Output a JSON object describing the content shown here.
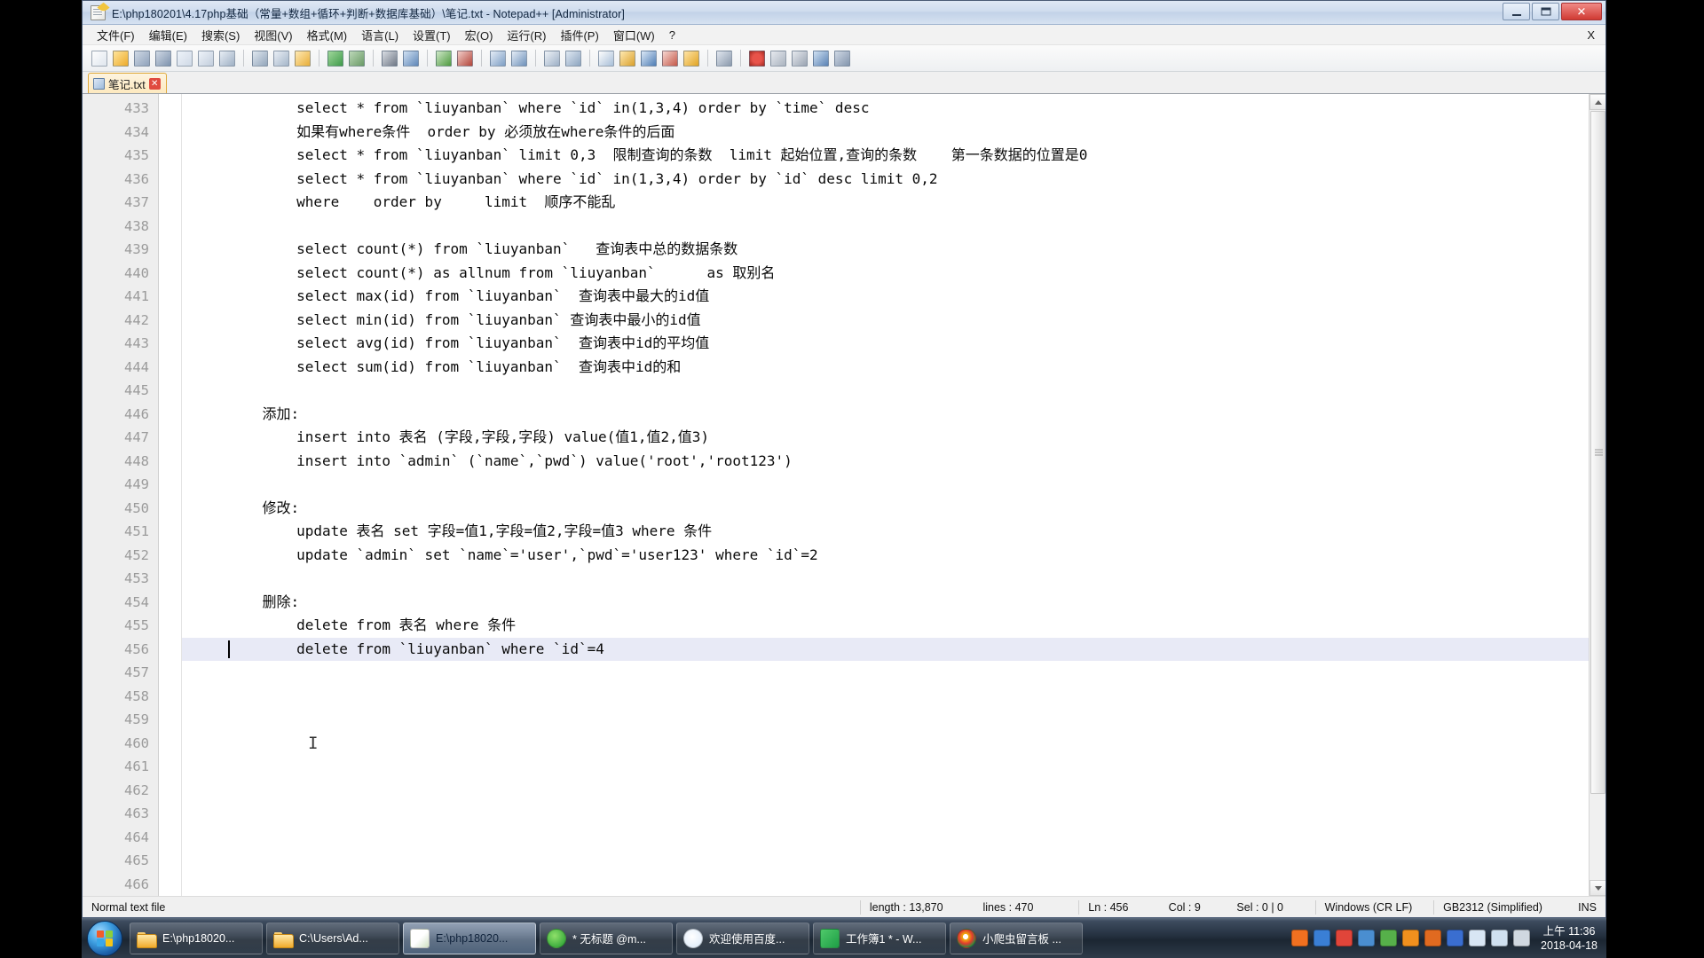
{
  "window": {
    "title": "E:\\php180201\\4.17php基础（常量+数组+循环+判断+数据库基础）\\笔记.txt - Notepad++ [Administrator]",
    "icon": "notepad-plus-plus-icon",
    "minimize_label": "—",
    "maximize_label": "▢",
    "close_label": "✕"
  },
  "menu": {
    "items": [
      {
        "label": "文件(F)"
      },
      {
        "label": "编辑(E)"
      },
      {
        "label": "搜索(S)"
      },
      {
        "label": "视图(V)"
      },
      {
        "label": "格式(M)"
      },
      {
        "label": "语言(L)"
      },
      {
        "label": "设置(T)"
      },
      {
        "label": "宏(O)"
      },
      {
        "label": "运行(R)"
      },
      {
        "label": "插件(P)"
      },
      {
        "label": "窗口(W)"
      },
      {
        "label": "?"
      }
    ],
    "close_doc_label": "X"
  },
  "toolbar": {
    "buttons": [
      {
        "name": "new-file-icon"
      },
      {
        "name": "open-file-icon"
      },
      {
        "name": "save-icon"
      },
      {
        "name": "save-all-icon"
      },
      {
        "name": "close-file-icon"
      },
      {
        "name": "close-all-icon"
      },
      {
        "name": "print-icon"
      },
      {
        "name": "separator"
      },
      {
        "name": "cut-icon"
      },
      {
        "name": "copy-icon"
      },
      {
        "name": "paste-icon"
      },
      {
        "name": "separator"
      },
      {
        "name": "undo-icon"
      },
      {
        "name": "redo-icon"
      },
      {
        "name": "separator"
      },
      {
        "name": "find-icon"
      },
      {
        "name": "replace-icon"
      },
      {
        "name": "separator"
      },
      {
        "name": "zoom-in-icon"
      },
      {
        "name": "zoom-out-icon"
      },
      {
        "name": "separator"
      },
      {
        "name": "sync-vertical-icon"
      },
      {
        "name": "sync-horizontal-icon"
      },
      {
        "name": "separator"
      },
      {
        "name": "word-wrap-icon"
      },
      {
        "name": "show-all-chars-icon"
      },
      {
        "name": "separator"
      },
      {
        "name": "indent-guide-icon"
      },
      {
        "name": "user-define-dialog-icon"
      },
      {
        "name": "document-map-icon"
      },
      {
        "name": "function-list-icon"
      },
      {
        "name": "folder-as-workspace-icon"
      },
      {
        "name": "separator"
      },
      {
        "name": "monitoring-icon"
      },
      {
        "name": "separator"
      },
      {
        "name": "macro-record-icon"
      },
      {
        "name": "macro-stop-icon"
      },
      {
        "name": "macro-play-icon"
      },
      {
        "name": "macro-playmulti-icon"
      },
      {
        "name": "macro-save-icon"
      }
    ]
  },
  "tabs": [
    {
      "label": "笔记.txt",
      "active": true,
      "icon": "saved-document-icon",
      "close": "✕"
    }
  ],
  "editor": {
    "first_line_number": 433,
    "current_line": 456,
    "lines": [
      {
        "n": 433,
        "text": "        select * from `liuyanban` where `id` in(1,3,4) order by `time` desc"
      },
      {
        "n": 434,
        "text": "        如果有where条件  order by 必须放在where条件的后面"
      },
      {
        "n": 435,
        "text": "        select * from `liuyanban` limit 0,3  限制查询的条数  limit 起始位置,查询的条数    第一条数据的位置是0"
      },
      {
        "n": 436,
        "text": "        select * from `liuyanban` where `id` in(1,3,4) order by `id` desc limit 0,2"
      },
      {
        "n": 437,
        "text": "        where    order by     limit  顺序不能乱"
      },
      {
        "n": 438,
        "text": ""
      },
      {
        "n": 439,
        "text": "        select count(*) from `liuyanban`   查询表中总的数据条数"
      },
      {
        "n": 440,
        "text": "        select count(*) as allnum from `liuyanban`      as 取别名"
      },
      {
        "n": 441,
        "text": "        select max(id) from `liuyanban`  查询表中最大的id值"
      },
      {
        "n": 442,
        "text": "        select min(id) from `liuyanban` 查询表中最小的id值"
      },
      {
        "n": 443,
        "text": "        select avg(id) from `liuyanban`  查询表中id的平均值"
      },
      {
        "n": 444,
        "text": "        select sum(id) from `liuyanban`  查询表中id的和"
      },
      {
        "n": 445,
        "text": ""
      },
      {
        "n": 446,
        "text": "    添加:"
      },
      {
        "n": 447,
        "text": "        insert into 表名 (字段,字段,字段) value(值1,值2,值3)"
      },
      {
        "n": 448,
        "text": "        insert into `admin` (`name`,`pwd`) value('root','root123')"
      },
      {
        "n": 449,
        "text": ""
      },
      {
        "n": 450,
        "text": "    修改:"
      },
      {
        "n": 451,
        "text": "        update 表名 set 字段=值1,字段=值2,字段=值3 where 条件"
      },
      {
        "n": 452,
        "text": "        update `admin` set `name`='user',`pwd`='user123' where `id`=2"
      },
      {
        "n": 453,
        "text": ""
      },
      {
        "n": 454,
        "text": "    删除:"
      },
      {
        "n": 455,
        "text": "        delete from 表名 where 条件"
      },
      {
        "n": 456,
        "text": "        delete from `liuyanban` where `id`=4"
      },
      {
        "n": 457,
        "text": ""
      },
      {
        "n": 458,
        "text": ""
      },
      {
        "n": 459,
        "text": ""
      },
      {
        "n": 460,
        "text": ""
      },
      {
        "n": 461,
        "text": ""
      },
      {
        "n": 462,
        "text": ""
      },
      {
        "n": 463,
        "text": ""
      },
      {
        "n": 464,
        "text": ""
      },
      {
        "n": 465,
        "text": ""
      },
      {
        "n": 466,
        "text": ""
      }
    ],
    "mouse_cursor_glyph": "I"
  },
  "scrollbar": {
    "up_arrow": "▲",
    "down_arrow": "▼"
  },
  "statusbar": {
    "file_type": "Normal text file",
    "length": "length : 13,870",
    "lines": "lines : 470",
    "ln": "Ln : 456",
    "col": "Col : 9",
    "sel": "Sel : 0 | 0",
    "eol": "Windows (CR LF)",
    "encoding": "GB2312 (Simplified)",
    "insert_mode": "INS"
  },
  "taskbar": {
    "start_label": "start-orb",
    "items": [
      {
        "label": "E:\\php18020...",
        "icon": "folder-icon",
        "active": false
      },
      {
        "label": "C:\\Users\\Ad...",
        "icon": "folder-icon",
        "active": false
      },
      {
        "label": "E:\\php18020...",
        "icon": "notepad-plus-plus-icon",
        "active": true
      },
      {
        "label": "* 无标题 @m...",
        "icon": "browser-green-icon",
        "active": false
      },
      {
        "label": "欢迎使用百度...",
        "icon": "baidu-icon",
        "active": false
      },
      {
        "label": "工作簿1 * - W...",
        "icon": "wps-spreadsheet-icon",
        "active": false
      },
      {
        "label": "小爬虫留言板 ...",
        "icon": "chrome-icon",
        "active": false
      }
    ],
    "tray_icons": [
      {
        "name": "sogou-input-icon",
        "color": "#f07020"
      },
      {
        "name": "shield-blue-icon",
        "color": "#3a7fd5"
      },
      {
        "name": "flower-red-icon",
        "color": "#e0453a"
      },
      {
        "name": "app-tray-icon",
        "color": "#4a8ed0"
      },
      {
        "name": "download-green-icon",
        "color": "#56b04a"
      },
      {
        "name": "security-orange-icon",
        "color": "#f0901e"
      },
      {
        "name": "tray-app-icon",
        "color": "#e06a20"
      },
      {
        "name": "baidu-tray-icon",
        "color": "#3a6ed0"
      },
      {
        "name": "volume-icon",
        "color": "#d8e6f4"
      },
      {
        "name": "network-icon",
        "color": "#cfe0f0"
      },
      {
        "name": "action-center-icon",
        "color": "#d0d8e0"
      }
    ],
    "clock_time": "上午 11:36",
    "clock_date": "2018-04-18"
  }
}
